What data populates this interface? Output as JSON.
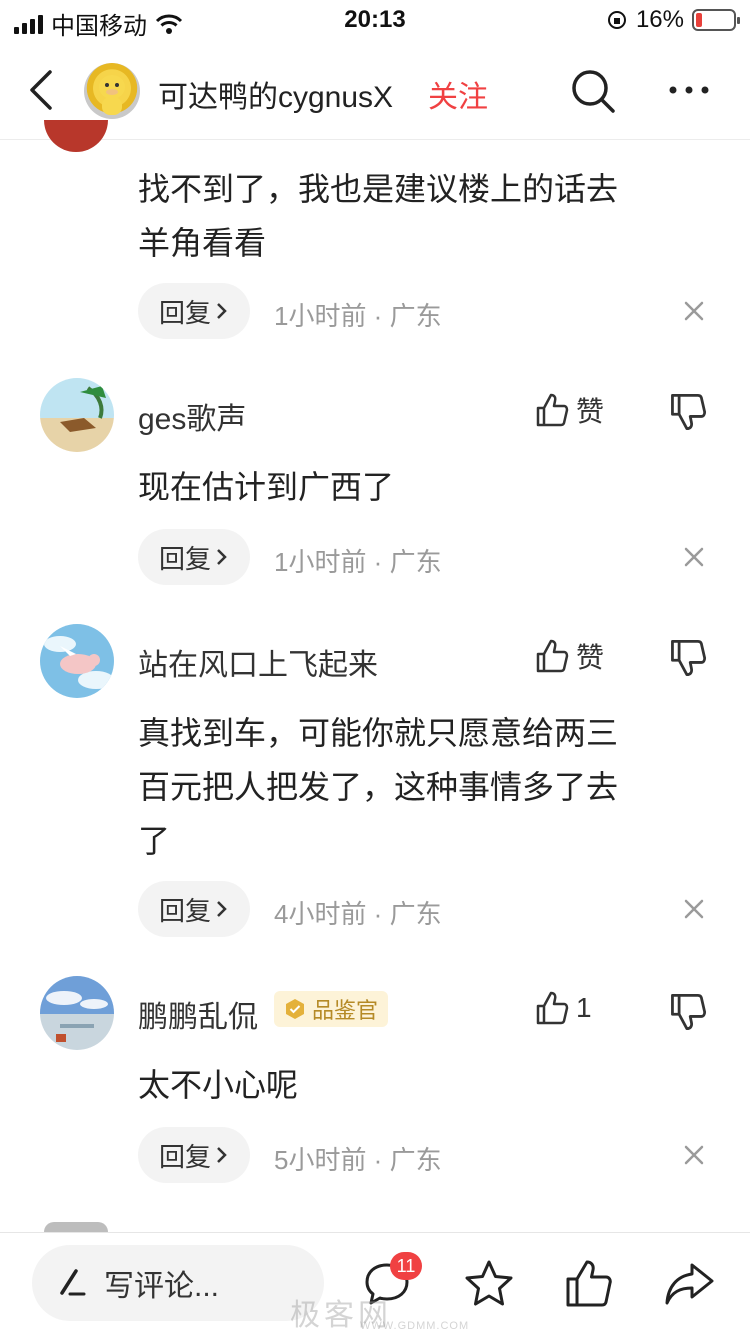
{
  "status_bar": {
    "carrier": "中国移动",
    "time": "20:13",
    "battery": "16%",
    "battery_level": 0.16
  },
  "nav": {
    "author_name": "可达鸭的cygnusX",
    "follow_label": "关注"
  },
  "comments": [
    {
      "text_line1": "找不到了，我也是建议楼上的话去",
      "text_line2": "羊角看看",
      "reply_label": "回复",
      "meta": "1小时前 · 广东"
    },
    {
      "username": "ges歌声",
      "like_label": "赞",
      "text": "现在估计到广西了",
      "reply_label": "回复",
      "meta": "1小时前 · 广东"
    },
    {
      "username": "站在风口上飞起来",
      "like_label": "赞",
      "text_line1": "真找到车，可能你就只愿意给两三",
      "text_line2": "百元把人把发了，这种事情多了去",
      "text_line3": "了",
      "reply_label": "回复",
      "meta": "4小时前 · 广东"
    },
    {
      "username": "鹏鹏乱侃",
      "badge": "品鉴官",
      "like_label": "1",
      "text": "太不小心呢",
      "reply_label": "回复",
      "meta": "5小时前 · 广东"
    }
  ],
  "bottom_bar": {
    "write_comment": "写评论...",
    "comment_count": "11"
  },
  "watermark": {
    "text": "极客网",
    "url": "WWW.GDMM.COM"
  },
  "colors": {
    "accent_red": "#f04142",
    "meta_gray": "#9a9a9a",
    "badge_gold": "#b58a26"
  }
}
